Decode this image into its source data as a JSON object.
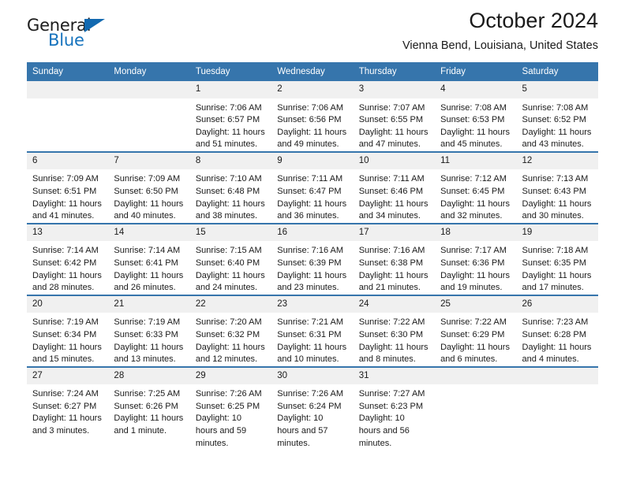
{
  "brand": {
    "word_one": "General",
    "word_two": "Blue",
    "triangle_color": "#1269b0",
    "blue_color": "#1673bd"
  },
  "header": {
    "title": "October 2024",
    "subtitle": "Vienna Bend, Louisiana, United States"
  },
  "theme": {
    "header_row_bg": "#3675ac",
    "daynum_bg": "#f0f0f0",
    "page_bg": "#ffffff",
    "text": "#1a1a1a"
  },
  "weekday_headers": [
    "Sunday",
    "Monday",
    "Tuesday",
    "Wednesday",
    "Thursday",
    "Friday",
    "Saturday"
  ],
  "weeks": [
    [
      {
        "day": "",
        "sunrise": "",
        "sunset": "",
        "daylight": ""
      },
      {
        "day": "",
        "sunrise": "",
        "sunset": "",
        "daylight": ""
      },
      {
        "day": "1",
        "sunrise": "Sunrise: 7:06 AM",
        "sunset": "Sunset: 6:57 PM",
        "daylight": "Daylight: 11 hours and 51 minutes."
      },
      {
        "day": "2",
        "sunrise": "Sunrise: 7:06 AM",
        "sunset": "Sunset: 6:56 PM",
        "daylight": "Daylight: 11 hours and 49 minutes."
      },
      {
        "day": "3",
        "sunrise": "Sunrise: 7:07 AM",
        "sunset": "Sunset: 6:55 PM",
        "daylight": "Daylight: 11 hours and 47 minutes."
      },
      {
        "day": "4",
        "sunrise": "Sunrise: 7:08 AM",
        "sunset": "Sunset: 6:53 PM",
        "daylight": "Daylight: 11 hours and 45 minutes."
      },
      {
        "day": "5",
        "sunrise": "Sunrise: 7:08 AM",
        "sunset": "Sunset: 6:52 PM",
        "daylight": "Daylight: 11 hours and 43 minutes."
      }
    ],
    [
      {
        "day": "6",
        "sunrise": "Sunrise: 7:09 AM",
        "sunset": "Sunset: 6:51 PM",
        "daylight": "Daylight: 11 hours and 41 minutes."
      },
      {
        "day": "7",
        "sunrise": "Sunrise: 7:09 AM",
        "sunset": "Sunset: 6:50 PM",
        "daylight": "Daylight: 11 hours and 40 minutes."
      },
      {
        "day": "8",
        "sunrise": "Sunrise: 7:10 AM",
        "sunset": "Sunset: 6:48 PM",
        "daylight": "Daylight: 11 hours and 38 minutes."
      },
      {
        "day": "9",
        "sunrise": "Sunrise: 7:11 AM",
        "sunset": "Sunset: 6:47 PM",
        "daylight": "Daylight: 11 hours and 36 minutes."
      },
      {
        "day": "10",
        "sunrise": "Sunrise: 7:11 AM",
        "sunset": "Sunset: 6:46 PM",
        "daylight": "Daylight: 11 hours and 34 minutes."
      },
      {
        "day": "11",
        "sunrise": "Sunrise: 7:12 AM",
        "sunset": "Sunset: 6:45 PM",
        "daylight": "Daylight: 11 hours and 32 minutes."
      },
      {
        "day": "12",
        "sunrise": "Sunrise: 7:13 AM",
        "sunset": "Sunset: 6:43 PM",
        "daylight": "Daylight: 11 hours and 30 minutes."
      }
    ],
    [
      {
        "day": "13",
        "sunrise": "Sunrise: 7:14 AM",
        "sunset": "Sunset: 6:42 PM",
        "daylight": "Daylight: 11 hours and 28 minutes."
      },
      {
        "day": "14",
        "sunrise": "Sunrise: 7:14 AM",
        "sunset": "Sunset: 6:41 PM",
        "daylight": "Daylight: 11 hours and 26 minutes."
      },
      {
        "day": "15",
        "sunrise": "Sunrise: 7:15 AM",
        "sunset": "Sunset: 6:40 PM",
        "daylight": "Daylight: 11 hours and 24 minutes."
      },
      {
        "day": "16",
        "sunrise": "Sunrise: 7:16 AM",
        "sunset": "Sunset: 6:39 PM",
        "daylight": "Daylight: 11 hours and 23 minutes."
      },
      {
        "day": "17",
        "sunrise": "Sunrise: 7:16 AM",
        "sunset": "Sunset: 6:38 PM",
        "daylight": "Daylight: 11 hours and 21 minutes."
      },
      {
        "day": "18",
        "sunrise": "Sunrise: 7:17 AM",
        "sunset": "Sunset: 6:36 PM",
        "daylight": "Daylight: 11 hours and 19 minutes."
      },
      {
        "day": "19",
        "sunrise": "Sunrise: 7:18 AM",
        "sunset": "Sunset: 6:35 PM",
        "daylight": "Daylight: 11 hours and 17 minutes."
      }
    ],
    [
      {
        "day": "20",
        "sunrise": "Sunrise: 7:19 AM",
        "sunset": "Sunset: 6:34 PM",
        "daylight": "Daylight: 11 hours and 15 minutes."
      },
      {
        "day": "21",
        "sunrise": "Sunrise: 7:19 AM",
        "sunset": "Sunset: 6:33 PM",
        "daylight": "Daylight: 11 hours and 13 minutes."
      },
      {
        "day": "22",
        "sunrise": "Sunrise: 7:20 AM",
        "sunset": "Sunset: 6:32 PM",
        "daylight": "Daylight: 11 hours and 12 minutes."
      },
      {
        "day": "23",
        "sunrise": "Sunrise: 7:21 AM",
        "sunset": "Sunset: 6:31 PM",
        "daylight": "Daylight: 11 hours and 10 minutes."
      },
      {
        "day": "24",
        "sunrise": "Sunrise: 7:22 AM",
        "sunset": "Sunset: 6:30 PM",
        "daylight": "Daylight: 11 hours and 8 minutes."
      },
      {
        "day": "25",
        "sunrise": "Sunrise: 7:22 AM",
        "sunset": "Sunset: 6:29 PM",
        "daylight": "Daylight: 11 hours and 6 minutes."
      },
      {
        "day": "26",
        "sunrise": "Sunrise: 7:23 AM",
        "sunset": "Sunset: 6:28 PM",
        "daylight": "Daylight: 11 hours and 4 minutes."
      }
    ],
    [
      {
        "day": "27",
        "sunrise": "Sunrise: 7:24 AM",
        "sunset": "Sunset: 6:27 PM",
        "daylight": "Daylight: 11 hours and 3 minutes."
      },
      {
        "day": "28",
        "sunrise": "Sunrise: 7:25 AM",
        "sunset": "Sunset: 6:26 PM",
        "daylight": "Daylight: 11 hours and 1 minute."
      },
      {
        "day": "29",
        "sunrise": "Sunrise: 7:26 AM",
        "sunset": "Sunset: 6:25 PM",
        "daylight": "Daylight: 10 hours and 59 minutes."
      },
      {
        "day": "30",
        "sunrise": "Sunrise: 7:26 AM",
        "sunset": "Sunset: 6:24 PM",
        "daylight": "Daylight: 10 hours and 57 minutes."
      },
      {
        "day": "31",
        "sunrise": "Sunrise: 7:27 AM",
        "sunset": "Sunset: 6:23 PM",
        "daylight": "Daylight: 10 hours and 56 minutes."
      },
      {
        "day": "",
        "sunrise": "",
        "sunset": "",
        "daylight": ""
      },
      {
        "day": "",
        "sunrise": "",
        "sunset": "",
        "daylight": ""
      }
    ]
  ]
}
